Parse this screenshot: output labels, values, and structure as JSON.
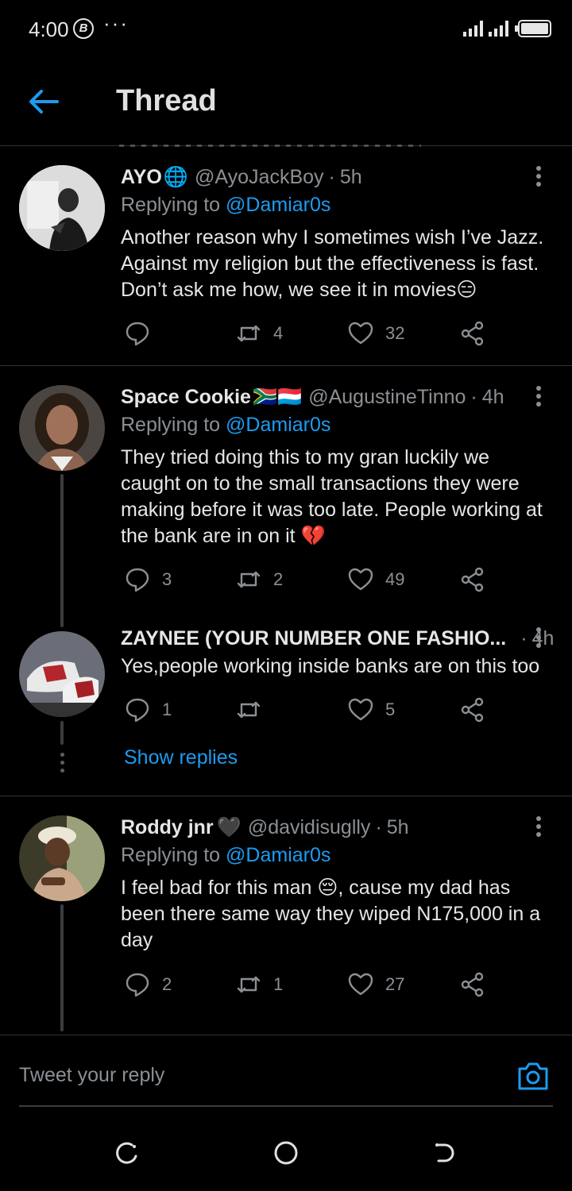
{
  "status_bar": {
    "time": "4:00",
    "badge": "B",
    "more": "···"
  },
  "header": {
    "title": "Thread",
    "back_icon": "arrow-left-icon"
  },
  "colors": {
    "accent": "#1d9bf0",
    "background": "#000000",
    "muted": "#8b9095"
  },
  "tweets": [
    {
      "name": "AYO",
      "name_badge": "🌐",
      "handle": "@AyoJackBoy",
      "time": "5h",
      "replying_prefix": "Replying to",
      "replying_to": "@Damiar0s",
      "text": "Another reason why I sometimes wish I’ve Jazz. Against my religion but the effectiveness is fast. Don’t ask me how, we see it in movies😑",
      "replies": "",
      "retweets": "4",
      "likes": "32"
    },
    {
      "name": "Space Cookie",
      "name_badge": "🇿🇦🇱🇺",
      "handle": "@AugustineTinno",
      "time": "4h",
      "replying_prefix": "Replying to",
      "replying_to": "@Damiar0s",
      "text": "They tried doing this to my gran luckily we caught on to the small transactions they were making before it was too late. People working at the bank are in on it 💔",
      "replies": "3",
      "retweets": "2",
      "likes": "49"
    },
    {
      "name": "ZAYNEE (YOUR NUMBER ONE FASHIO...",
      "handle": "",
      "time": "4h",
      "text": "Yes,people working inside banks are on this too",
      "replies": "1",
      "retweets": "",
      "likes": "5"
    },
    {
      "name": "Roddy jnr",
      "name_badge": "🖤",
      "handle": "@davidisuglly",
      "time": "5h",
      "replying_prefix": "Replying to",
      "replying_to": "@Damiar0s",
      "text": "I feel bad for this man 😔, cause my dad has been there same way they wiped N175,000 in a day",
      "replies": "2",
      "retweets": "1",
      "likes": "27"
    }
  ],
  "show_replies": "Show replies",
  "reply_bar": {
    "placeholder": "Tweet your reply",
    "camera_icon": "camera-icon"
  },
  "nav": {
    "back": "nav-back-icon",
    "home": "nav-home-icon",
    "recents": "nav-recents-icon"
  }
}
